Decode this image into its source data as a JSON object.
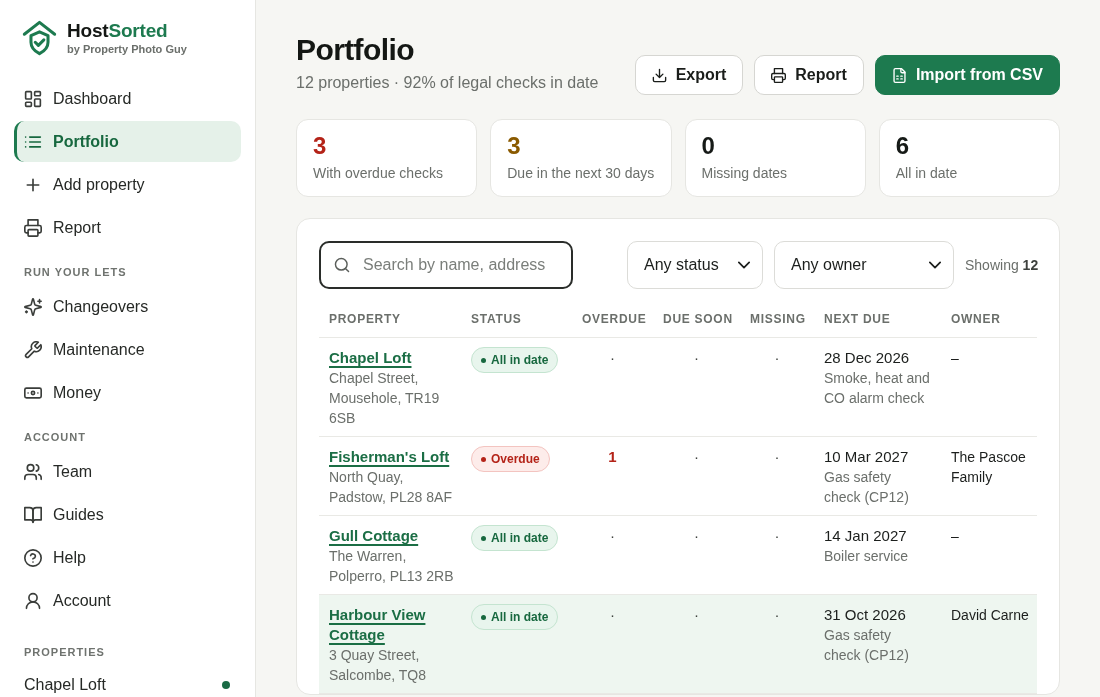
{
  "brand": {
    "name_parts": [
      "Host",
      "Sorted"
    ],
    "tagline": "by Property Photo Guy"
  },
  "sidebar": {
    "sections": [
      {
        "items": [
          {
            "label": "Dashboard",
            "selected": false
          },
          {
            "label": "Portfolio",
            "selected": true
          },
          {
            "label": "Add property",
            "selected": false
          },
          {
            "label": "Report",
            "selected": false
          }
        ]
      },
      {
        "heading": "RUN YOUR LETS",
        "items": [
          {
            "label": "Changeovers",
            "selected": false
          },
          {
            "label": "Maintenance",
            "selected": false
          },
          {
            "label": "Money",
            "selected": false
          }
        ]
      },
      {
        "heading": "ACCOUNT",
        "items": [
          {
            "label": "Team",
            "selected": false
          },
          {
            "label": "Guides",
            "selected": false
          },
          {
            "label": "Help",
            "selected": false
          },
          {
            "label": "Account",
            "selected": false
          }
        ]
      }
    ],
    "properties": {
      "heading": "PROPERTIES",
      "items": [
        {
          "name": "Chapel Loft",
          "color": "#1a6b45"
        }
      ]
    }
  },
  "page": {
    "title": "Portfolio",
    "subtitle": "12 properties · 92% of legal checks in date"
  },
  "actions": [
    {
      "label": "Export",
      "kind": "secondary"
    },
    {
      "label": "Report",
      "kind": "secondary"
    },
    {
      "label": "Import from CSV",
      "kind": "primary"
    }
  ],
  "stats": [
    {
      "value": "3",
      "label": "With overdue checks",
      "color": "#b42318"
    },
    {
      "value": "3",
      "label": "Due in the next 30 days",
      "color": "#8a5a00"
    },
    {
      "value": "0",
      "label": "Missing dates",
      "color": "#161a17"
    },
    {
      "value": "6",
      "label": "All in date",
      "color": "#161a17"
    }
  ],
  "table": {
    "search": {
      "placeholder": "Search by name, address"
    },
    "filters": [
      {
        "value": "Any status"
      },
      {
        "value": "Any owner"
      }
    ],
    "count": "Showing **12**",
    "columns": [
      "PROPERTY",
      "STATUS",
      "OVERDUE",
      "DUE SOON",
      "MISSING",
      "NEXT DUE",
      "OWNER"
    ],
    "rows": [
      {
        "name": "Chapel Loft",
        "address": "Chapel Street, Mousehole, TR19 6SB",
        "status": {
          "label": "All in date",
          "kind": "ok"
        },
        "overdue": "·",
        "due_soon": "·",
        "missing": "·",
        "next_due": "28 Dec 2026",
        "next_check": "Smoke, heat and CO alarm check",
        "owner": "–",
        "highlighted": false
      },
      {
        "name": "Fisherman's Loft",
        "address": "North Quay, Padstow, PL28 8AF",
        "status": {
          "label": "Overdue",
          "kind": "overdue"
        },
        "overdue": "1",
        "due_soon": "·",
        "missing": "·",
        "next_due": "10 Mar 2027",
        "next_check": "Gas safety check (CP12)",
        "owner": "The Pascoe Family",
        "highlighted": false
      },
      {
        "name": "Gull Cottage",
        "address": "The Warren, Polperro, PL13 2RB",
        "status": {
          "label": "All in date",
          "kind": "ok"
        },
        "overdue": "·",
        "due_soon": "·",
        "missing": "·",
        "next_due": "14 Jan 2027",
        "next_check": "Boiler service",
        "owner": "–",
        "highlighted": false
      },
      {
        "name": "Harbour View Cottage",
        "address": "3 Quay Street, Salcombe, TQ8",
        "status": {
          "label": "All in date",
          "kind": "ok"
        },
        "overdue": "·",
        "due_soon": "·",
        "missing": "·",
        "next_due": "31 Oct 2026",
        "next_check": "Gas safety check (CP12)",
        "owner": "David Carne",
        "highlighted": true
      }
    ]
  }
}
